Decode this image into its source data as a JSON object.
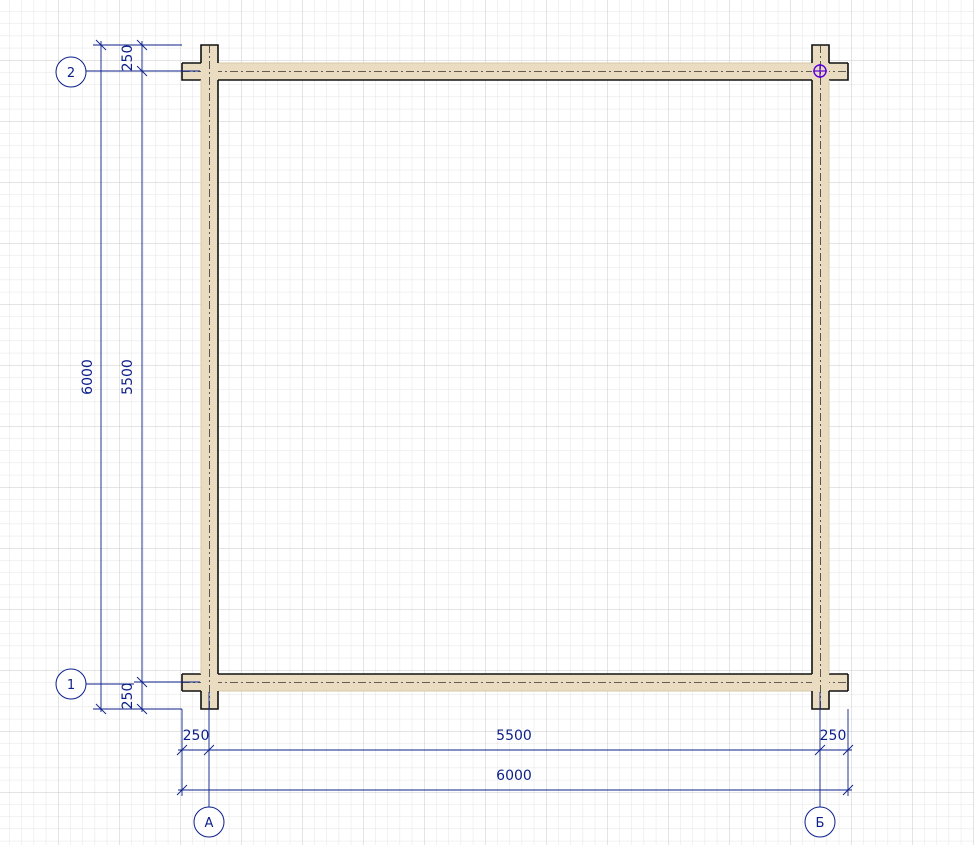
{
  "axes": {
    "rows": [
      {
        "label": "2"
      },
      {
        "label": "1"
      }
    ],
    "columns": [
      {
        "label": "А"
      },
      {
        "label": "Б"
      }
    ]
  },
  "dimensions": {
    "vertical": {
      "top_offset": "250",
      "inner": "5500",
      "overall": "6000",
      "bottom_offset": "250"
    },
    "horizontal": {
      "left_offset": "250",
      "inner": "5500",
      "right_offset": "250",
      "overall": "6000"
    }
  },
  "colors": {
    "grid_minor": "#e4e4e4",
    "grid_major": "#c8c8c8",
    "dimension": "#0b1f8a",
    "wall_fill": "#e9dcc1",
    "wall_outline": "#111111",
    "snap_marker": "#5b00d6"
  }
}
